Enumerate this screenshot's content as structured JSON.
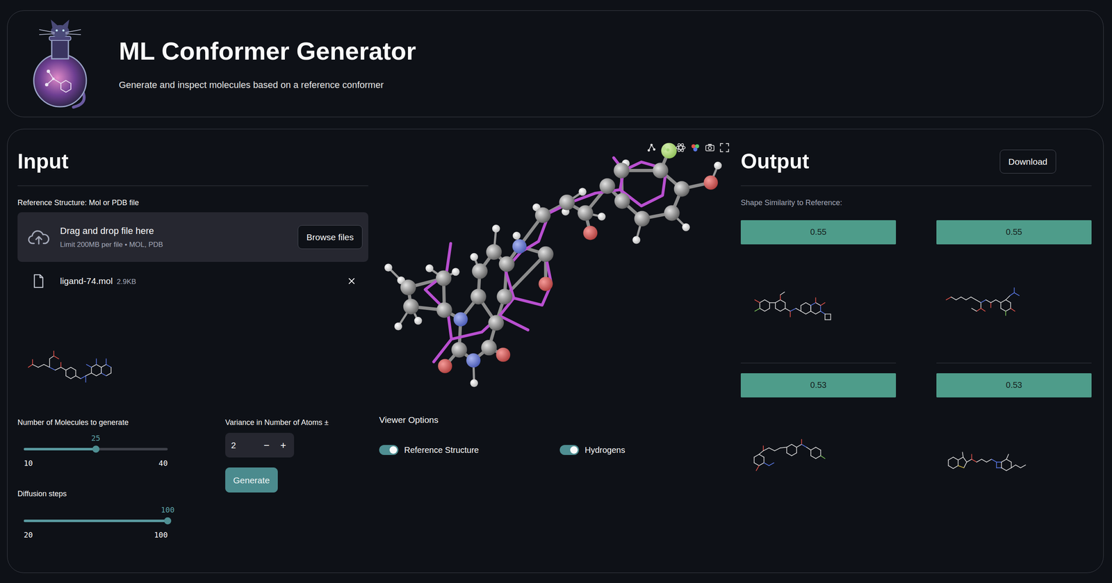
{
  "header": {
    "title": "ML Conformer Generator",
    "subtitle": "Generate and inspect molecules based on a reference conformer"
  },
  "input": {
    "heading": "Input",
    "uploader": {
      "label": "Reference Structure: Mol or PDB file",
      "prompt": "Drag and drop file here",
      "hint": "Limit 200MB per file • MOL, PDB",
      "button": "Browse files"
    },
    "file": {
      "name": "ligand-74.mol",
      "size": "2.9KB"
    },
    "sliders": [
      {
        "label": "Number of Molecules to generate",
        "value": "25",
        "min": "10",
        "max": "40",
        "level": 0.5
      },
      {
        "label": "Diffusion steps",
        "value": "100",
        "min": "20",
        "max": "100",
        "level": 1
      }
    ],
    "variance": {
      "label": "Variance in Number of Atoms ±",
      "value": "2",
      "decrement": "−",
      "increment": "+"
    },
    "generate": "Generate"
  },
  "viewer": {
    "options_title": "Viewer Options",
    "toggles": [
      {
        "label": "Reference Structure",
        "on": true
      },
      {
        "label": "Hydrogens",
        "on": true
      }
    ]
  },
  "output": {
    "heading": "Output",
    "download": "Download",
    "similarity_label": "Shape Similarity to Reference:",
    "results": [
      {
        "score": "0.55"
      },
      {
        "score": "0.55"
      },
      {
        "score": "0.53"
      },
      {
        "score": "0.53"
      }
    ]
  }
}
